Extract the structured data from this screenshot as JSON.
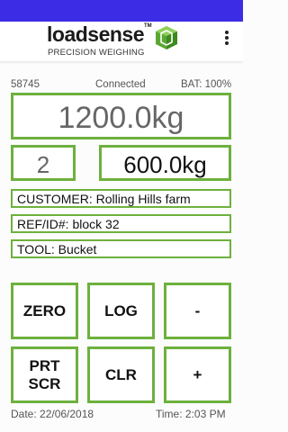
{
  "brand": {
    "name": "loadsense",
    "trademark": "TM",
    "tagline": "PRECISION WEIGHING",
    "accent": "#6db13d",
    "status_bar_color": "#3c2ce6"
  },
  "menu": {
    "icon": "overflow-menu-icon"
  },
  "status": {
    "device_id": "58745",
    "connection": "Connected",
    "battery": "BAT: 100%"
  },
  "readings": {
    "total": "1200.0kg",
    "count": "2",
    "last_weight": "600.0kg"
  },
  "fields": {
    "customer": "CUSTOMER: Rolling Hills farm",
    "reference": "REF/ID#: block 32",
    "tool": "TOOL: Bucket"
  },
  "buttons": {
    "zero": "ZERO",
    "log": "LOG",
    "minus": "-",
    "print_screen": "PRT SCR",
    "clear": "CLR",
    "plus": "+"
  },
  "footer": {
    "date": "Date: 22/06/2018",
    "time": "Time: 2:03 PM"
  }
}
